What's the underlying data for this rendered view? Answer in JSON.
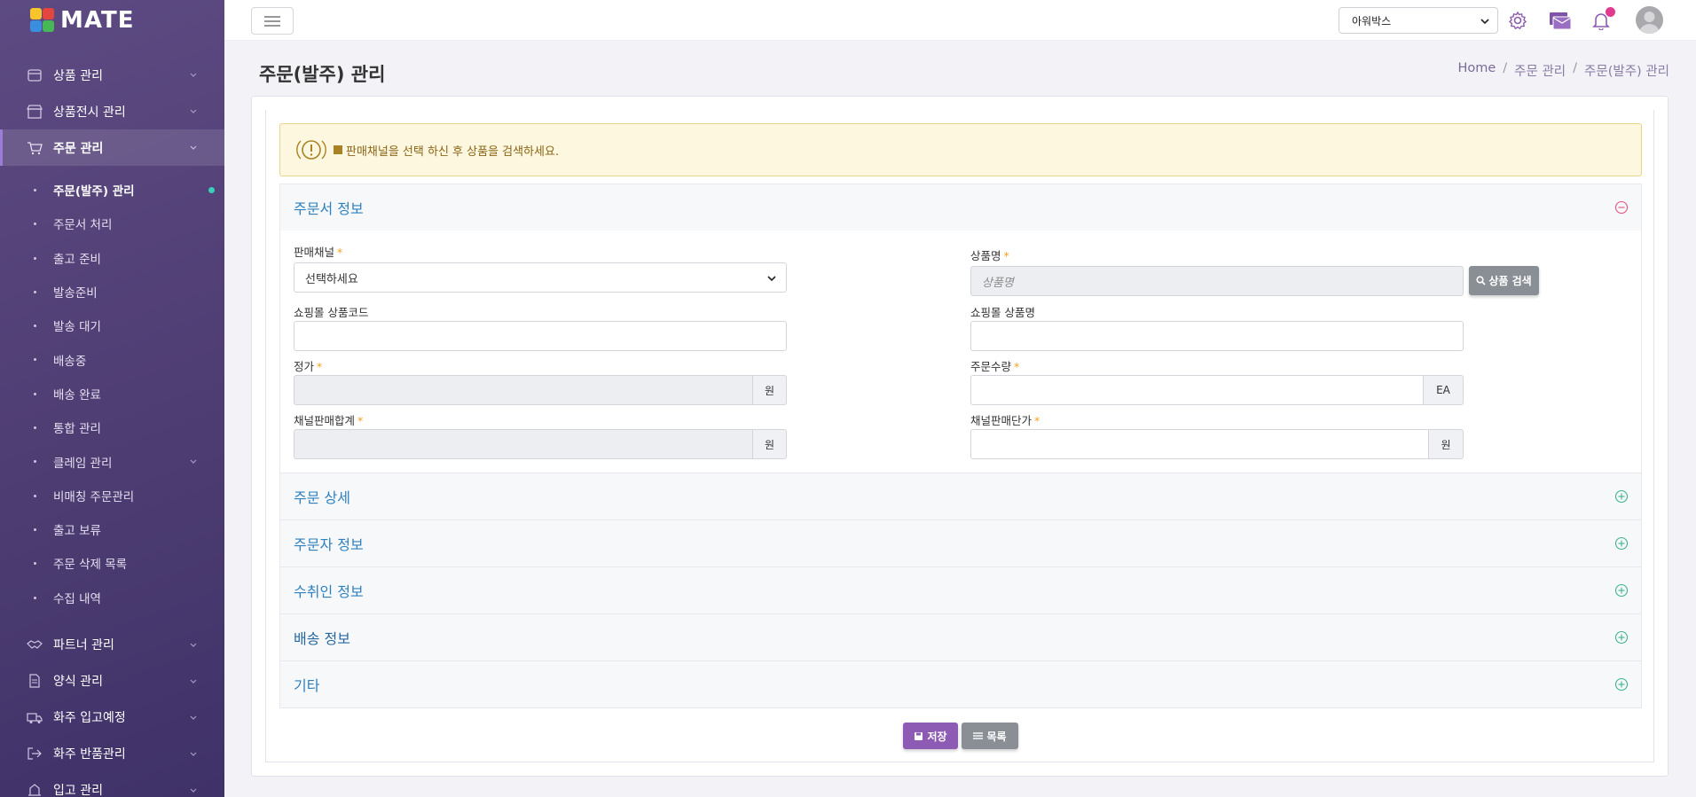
{
  "brand": {
    "name": "MATE"
  },
  "sidebar": {
    "items_top": [
      {
        "label": "상품 관리",
        "icon": "box-icon"
      },
      {
        "label": "상품전시 관리",
        "icon": "store-icon"
      },
      {
        "label": "주문 관리",
        "icon": "cart-icon"
      }
    ],
    "submenu": [
      {
        "label": "주문(발주) 관리"
      },
      {
        "label": "주문서 처리"
      },
      {
        "label": "출고 준비"
      },
      {
        "label": "발송준비"
      },
      {
        "label": "발송 대기"
      },
      {
        "label": "배송중"
      },
      {
        "label": "배송 완료"
      },
      {
        "label": "통합 관리"
      },
      {
        "label": "클레임 관리"
      },
      {
        "label": "비매칭 주문관리"
      },
      {
        "label": "출고 보류"
      },
      {
        "label": "주문 삭제 목록"
      },
      {
        "label": "수집 내역"
      }
    ],
    "items_bottom": [
      {
        "label": "파트너 관리",
        "icon": "handshake-icon"
      },
      {
        "label": "양식 관리",
        "icon": "document-icon"
      },
      {
        "label": "화주 입고예정",
        "icon": "truck-icon"
      },
      {
        "label": "화주 반품관리",
        "icon": "return-icon"
      },
      {
        "label": "입고 관리",
        "icon": "inbound-icon"
      }
    ]
  },
  "header": {
    "company_select": "아워박스"
  },
  "page": {
    "title": "주문(발주) 관리",
    "breadcrumb": [
      "Home",
      "주문 관리",
      "주문(발주) 관리"
    ]
  },
  "alert": {
    "text": "판매채널을 선택 하신 후 상품을 검색하세요."
  },
  "order_info": {
    "title": "주문서 정보",
    "fields": {
      "channel": {
        "label": "판매채널",
        "value": "선택하세요"
      },
      "product_name": {
        "label": "상품명",
        "placeholder": "상품명"
      },
      "search_button": "상품 검색",
      "mall_code": {
        "label": "쇼핑몰 상품코드",
        "value": ""
      },
      "mall_name": {
        "label": "쇼핑몰 상품명",
        "value": ""
      },
      "price": {
        "label": "정가",
        "unit": "원"
      },
      "quantity": {
        "label": "주문수량",
        "unit": "EA"
      },
      "channel_total": {
        "label": "채널판매합계",
        "unit": "원"
      },
      "channel_unit_price": {
        "label": "채널판매단가",
        "unit": "원"
      }
    }
  },
  "sections": [
    {
      "title": "주문 상세"
    },
    {
      "title": "주문자 정보"
    },
    {
      "title": "수취인 정보"
    },
    {
      "title": "배송 정보"
    },
    {
      "title": "기타"
    }
  ],
  "actions": {
    "save": "저장",
    "list": "목록"
  },
  "colors": {
    "sidebar": "#4f3e74",
    "accent": "#8d5bb3",
    "link": "#2e80bf",
    "alert_bg": "#fcf7de"
  }
}
